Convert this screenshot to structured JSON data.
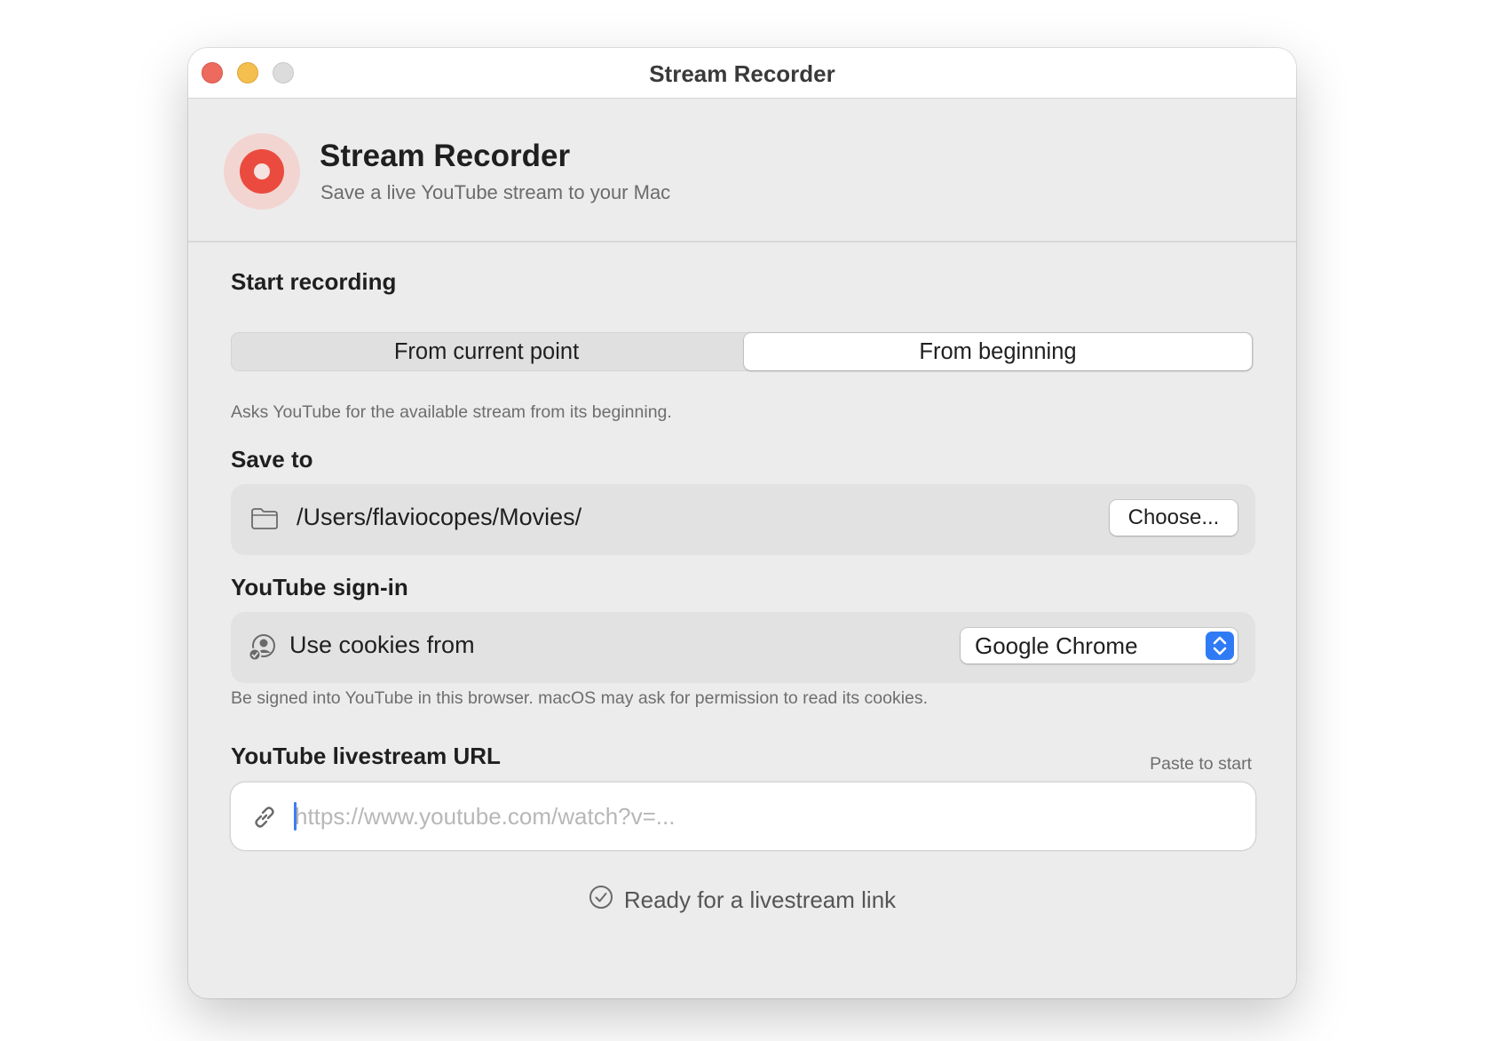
{
  "window": {
    "title": "Stream Recorder"
  },
  "header": {
    "app_name": "Stream Recorder",
    "subtitle": "Save a live YouTube stream to your Mac",
    "icon": "record-icon",
    "accent_color": "#eb4b3f"
  },
  "start_recording": {
    "label": "Start recording",
    "options": [
      "From current point",
      "From beginning"
    ],
    "selected": "From beginning",
    "help": "Asks YouTube for the available stream from its beginning."
  },
  "save_to": {
    "label": "Save to",
    "icon": "folder-icon",
    "path": "/Users/flaviocopes/Movies/",
    "choose_label": "Choose..."
  },
  "signin": {
    "label": "YouTube sign-in",
    "icon": "person-circle-icon",
    "cookies_label": "Use cookies from",
    "browser": "Google Chrome",
    "help": "Be signed into YouTube in this browser. macOS may ask for permission to read its cookies."
  },
  "url": {
    "label": "YouTube livestream URL",
    "hint": "Paste to start",
    "icon": "link-icon",
    "value": "",
    "placeholder": "https://www.youtube.com/watch?v=..."
  },
  "status": {
    "icon": "checkmark-circle-icon",
    "text": "Ready for a livestream link"
  }
}
